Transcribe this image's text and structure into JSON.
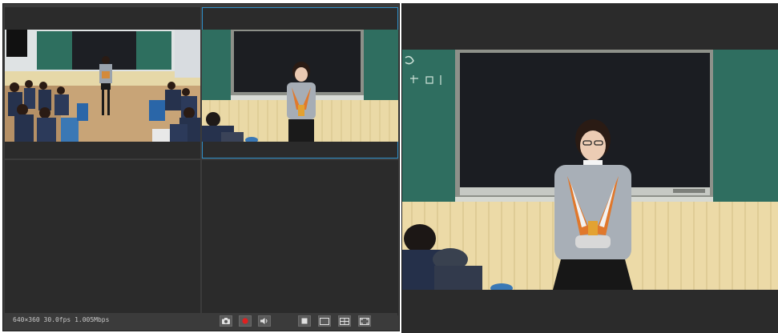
{
  "status": {
    "stream_info": "640×360 30.0fps 1.005Mbps"
  },
  "toolbar": {
    "icons": [
      "camera-icon",
      "record-icon",
      "volume-icon",
      "layout-single-icon",
      "layout-wide-icon",
      "layout-quad-icon",
      "fullscreen-icon"
    ]
  },
  "colors": {
    "panel_bg": "#2b2b2b",
    "frame_bg": "#3b3b3b",
    "active_border": "#2f8fc8",
    "record_red": "#e02020",
    "chalkboard_green": "#2e6f5f",
    "wall_wood": "#e9d9a8"
  }
}
